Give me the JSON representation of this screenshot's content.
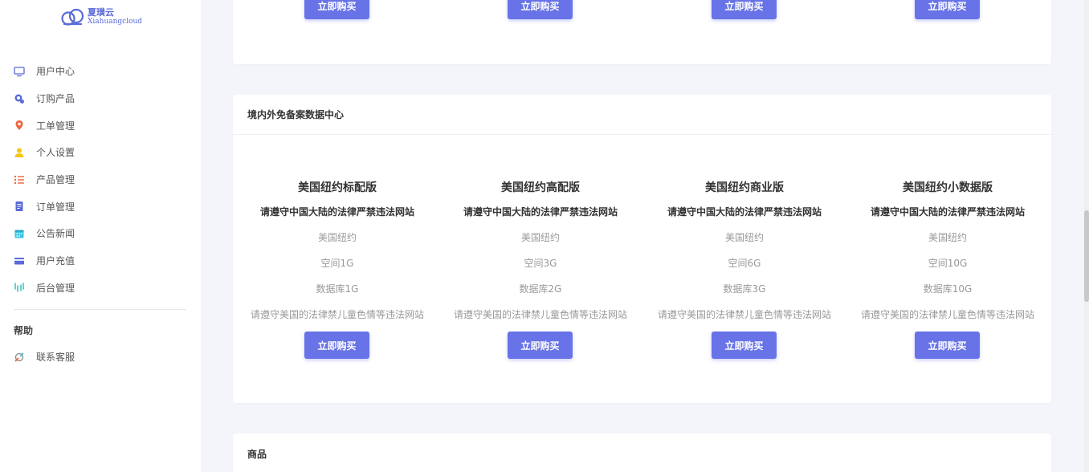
{
  "logo": {
    "cn": "夏璜云",
    "en": "Xiahuangcloud"
  },
  "colors": {
    "accent": "#6773e6",
    "sidebar_bg": "#ffffff",
    "page_bg": "#f4f5fa"
  },
  "sidebar": {
    "items": [
      {
        "label": "用户中心",
        "icon": "monitor-icon"
      },
      {
        "label": "订购产品",
        "icon": "shopping-icon"
      },
      {
        "label": "工单管理",
        "icon": "location-pin-icon"
      },
      {
        "label": "个人设置",
        "icon": "user-icon"
      },
      {
        "label": "产品管理",
        "icon": "list-icon"
      },
      {
        "label": "订单管理",
        "icon": "document-icon"
      },
      {
        "label": "公告新闻",
        "icon": "calendar-icon"
      },
      {
        "label": "用户充值",
        "icon": "credit-card-icon"
      },
      {
        "label": "后台管理",
        "icon": "chart-icon"
      }
    ],
    "help_title": "帮助",
    "help_items": [
      {
        "label": "联系客服",
        "icon": "support-icon"
      }
    ]
  },
  "top_card": {
    "buttons": [
      "立即购买",
      "立即购买",
      "立即购买",
      "立即购买"
    ]
  },
  "main_card": {
    "title": "境内外免备案数据中心",
    "products": [
      {
        "name": "美国纽约标配版",
        "notice": "请遵守中国大陆的法律严禁违法网站",
        "features": [
          "美国纽约",
          "空间1G",
          "数据库1G",
          "请遵守美国的法律禁儿童色情等违法网站"
        ],
        "button": "立即购买"
      },
      {
        "name": "美国纽约高配版",
        "notice": "请遵守中国大陆的法律严禁违法网站",
        "features": [
          "美国纽约",
          "空间3G",
          "数据库2G",
          "请遵守美国的法律禁儿童色情等违法网站"
        ],
        "button": "立即购买"
      },
      {
        "name": "美国纽约商业版",
        "notice": "请遵守中国大陆的法律严禁违法网站",
        "features": [
          "美国纽约",
          "空间6G",
          "数据库3G",
          "请遵守美国的法律禁儿童色情等违法网站"
        ],
        "button": "立即购买"
      },
      {
        "name": "美国纽约小数据版",
        "notice": "请遵守中国大陆的法律严禁违法网站",
        "features": [
          "美国纽约",
          "空间10G",
          "数据库10G",
          "请遵守美国的法律禁儿童色情等违法网站"
        ],
        "button": "立即购买"
      }
    ]
  },
  "bottom_card": {
    "title": "商品"
  }
}
